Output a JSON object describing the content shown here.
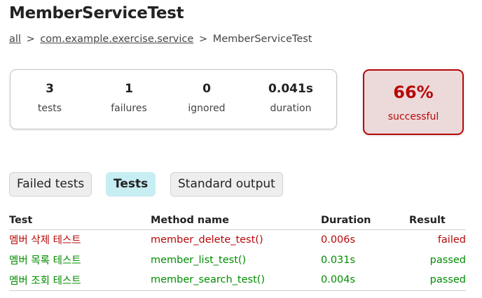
{
  "page": {
    "title": "MemberServiceTest"
  },
  "breadcrumb": {
    "all": "all",
    "sep1": ">",
    "package": "com.example.exercise.service",
    "sep2": ">",
    "current": "MemberServiceTest"
  },
  "summary": {
    "tests": {
      "value": "3",
      "label": "tests"
    },
    "failures": {
      "value": "1",
      "label": "failures"
    },
    "ignored": {
      "value": "0",
      "label": "ignored"
    },
    "duration": {
      "value": "0.041s",
      "label": "duration"
    }
  },
  "success": {
    "percent": "66%",
    "label": "successful"
  },
  "tabs": [
    {
      "label": "Failed tests",
      "active": false
    },
    {
      "label": "Tests",
      "active": true
    },
    {
      "label": "Standard output",
      "active": false
    }
  ],
  "table": {
    "headers": {
      "test": "Test",
      "method": "Method name",
      "duration": "Duration",
      "result": "Result"
    },
    "rows": [
      {
        "test": "멤버 삭제 테스트",
        "method": "member_delete_test()",
        "duration": "0.006s",
        "result": "failed"
      },
      {
        "test": "멤버 목록 테스트",
        "method": "member_list_test()",
        "duration": "0.031s",
        "result": "passed"
      },
      {
        "test": "멤버 조회 테스트",
        "method": "member_search_test()",
        "duration": "0.004s",
        "result": "passed"
      }
    ]
  },
  "colors": {
    "failed": "#b60808",
    "passed": "#008c00",
    "active_tab": "#c7eef2",
    "success_bg": "#ecdada"
  }
}
